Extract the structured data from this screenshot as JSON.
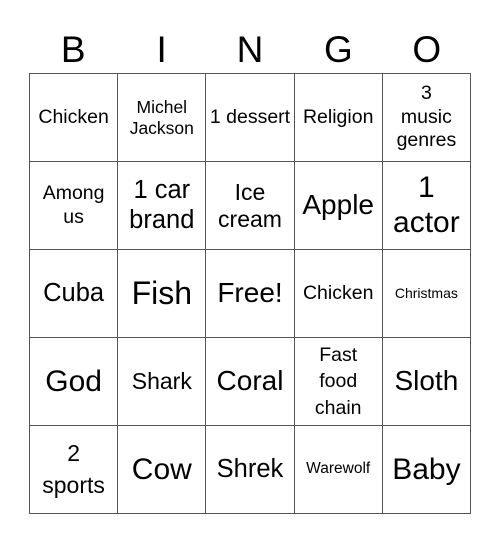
{
  "header": {
    "letters": [
      "B",
      "I",
      "N",
      "G",
      "O"
    ]
  },
  "card": {
    "rows": [
      [
        "Chicken",
        "Michel Jackson",
        "1 dessert",
        "Religion",
        "3 music genres"
      ],
      [
        "Among us",
        "1 car brand",
        "Ice cream",
        "Apple",
        "1 actor"
      ],
      [
        "Cuba",
        "Fish",
        "Free!",
        "Chicken",
        "Christmas"
      ],
      [
        "God",
        "Shark",
        "Coral",
        "Fast food chain",
        "Sloth"
      ],
      [
        "2 sports",
        "Cow",
        "Shrek",
        "Warewolf",
        "Baby"
      ]
    ]
  }
}
